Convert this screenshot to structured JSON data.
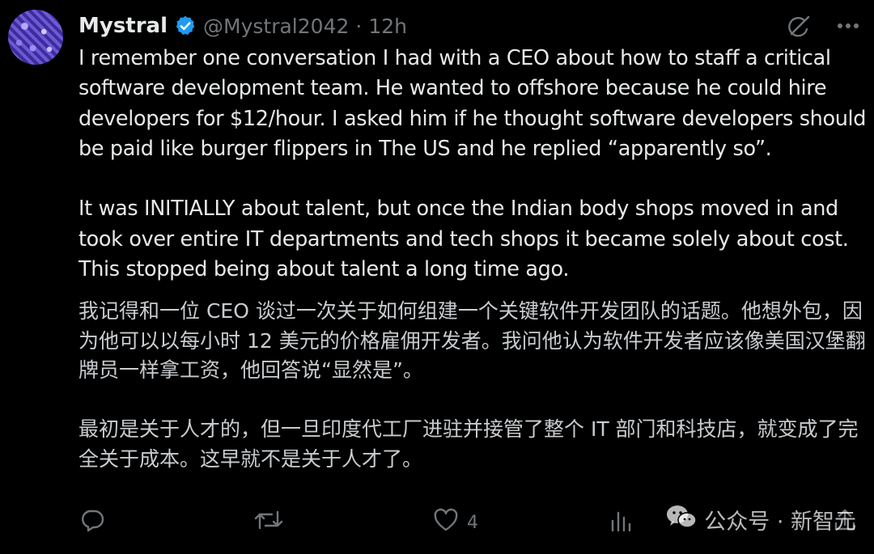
{
  "post": {
    "author_name": "Mystral",
    "handle": "@Mystral2042",
    "separator": "·",
    "time": "12h",
    "paragraphs": [
      "I remember one conversation I had with a CEO about how to staff a critical software development team.  He wanted to offshore because he could hire developers for $12/hour.  I asked him if he thought software developers should be paid like burger flippers in The US and he replied “apparently so”.",
      "It was INITIALLY about talent, but once the Indian body shops moved in and took over entire IT departments and tech shops it became solely about cost.  This stopped being about talent a long time ago."
    ],
    "translation": [
      "我记得和一位 CEO 谈过一次关于如何组建一个关键软件开发团队的话题。他想外包，因为他可以以每小时 12 美元的价格雇佣开发者。我问他认为软件开发者应该像美国汉堡翻牌员一样拿工资，他回答说“显然是”。",
      "最初是关于人才的，但一旦印度代工厂进驻并接管了整个 IT 部门和科技店，就变成了完全关于成本。这早就不是关于人才了。"
    ]
  },
  "actions": {
    "like_count": "4"
  },
  "watermark": {
    "text": "公众号 · 新智元"
  },
  "colors": {
    "background": "#000000",
    "text": "#e7e9ea",
    "secondary": "#71767b",
    "verified": "#1d9bf0"
  },
  "icons": [
    "verified-badge-icon",
    "grok-icon",
    "more-icon",
    "reply-icon",
    "retweet-icon",
    "like-icon",
    "views-icon",
    "wechat-icon",
    "share-icon"
  ]
}
